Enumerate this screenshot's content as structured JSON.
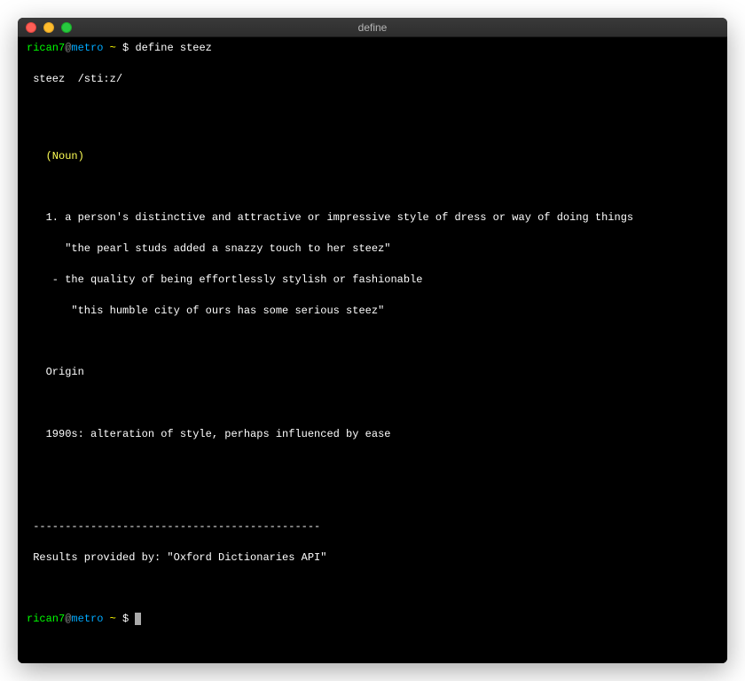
{
  "window": {
    "title": "define"
  },
  "prompt": {
    "user": "rican7",
    "at": "@",
    "host": "metro",
    "path": "~",
    "dollar": "$"
  },
  "command": "define steez",
  "output": {
    "headword_line": " steez  /sti:z/",
    "pos": "(Noun)",
    "def1": "   1. a person's distinctive and attractive or impressive style of dress or way of doing things",
    "ex1": "      \"the pearl studs added a snazzy touch to her steez\"",
    "sub1": "    - the quality of being effortlessly stylish or fashionable",
    "subex1": "       \"this humble city of ours has some serious steez\"",
    "origin_label": "   Origin",
    "origin_text": "   1990s: alteration of style, perhaps influenced by ease",
    "divider": " ---------------------------------------------",
    "attribution": " Results provided by: \"Oxford Dictionaries API\""
  }
}
